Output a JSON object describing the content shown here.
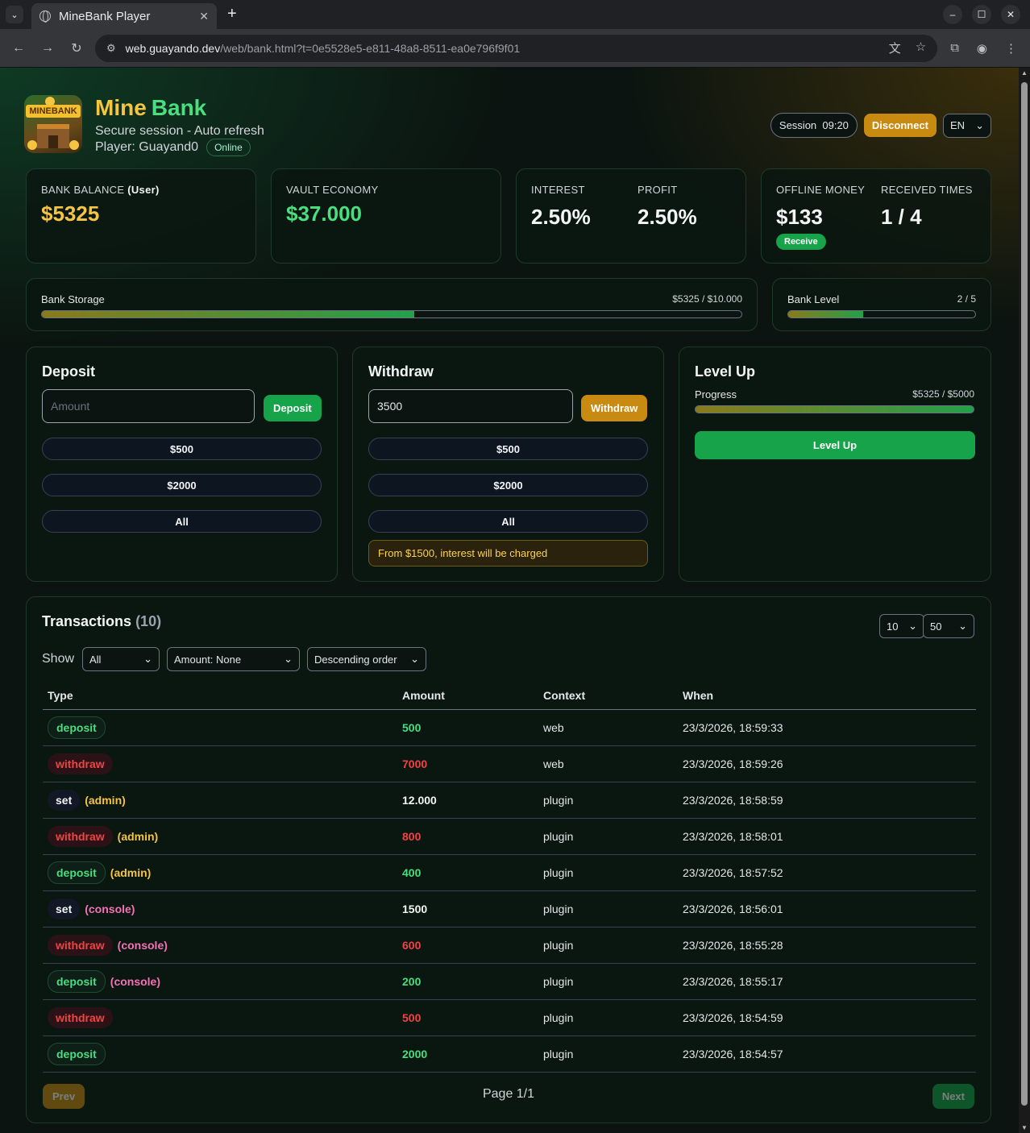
{
  "browser": {
    "tab_title": "MineBank Player",
    "url_host": "web.guayando.dev",
    "url_path": "/web/bank.html?t=0e5528e5-e811-48a8-8511-ea0e796f9f01"
  },
  "header": {
    "brand_1": "Mine",
    "brand_2": "Bank",
    "subtitle": "Secure session - Auto refresh",
    "player_label": "Player: Guayand0",
    "status": "Online",
    "session": "Session  09:20",
    "disconnect": "Disconnect",
    "lang": "EN",
    "logo_text": "MINEBANK"
  },
  "stats": {
    "bank_balance_label": "BANK BALANCE",
    "bank_balance_user": "(User)",
    "bank_balance": "$5325",
    "vault_label": "VAULT ECONOMY",
    "vault": "$37.000",
    "interest_label": "INTEREST",
    "interest": "2.50%",
    "profit_label": "PROFIT",
    "profit": "2.50%",
    "offline_label": "OFFLINE MONEY",
    "offline": "$133",
    "receive": "Receive",
    "received_label": "RECEIVED TIMES",
    "received": "1 / 4"
  },
  "storage": {
    "label": "Bank Storage",
    "value": "$5325 / $10.000",
    "fraction": 0.5325
  },
  "level": {
    "label": "Bank Level",
    "value": "2 / 5",
    "fraction": 0.4
  },
  "deposit": {
    "title": "Deposit",
    "placeholder": "Amount",
    "button": "Deposit",
    "q1": "$500",
    "q2": "$2000",
    "q3": "All"
  },
  "withdraw": {
    "title": "Withdraw",
    "value": "3500",
    "button": "Withdraw",
    "q1": "$500",
    "q2": "$2000",
    "q3": "All",
    "notice": "From $1500, interest will be charged"
  },
  "levelup": {
    "title": "Level Up",
    "progress_label": "Progress",
    "progress_value": "$5325 / $5000",
    "fraction": 1.0,
    "button": "Level Up"
  },
  "transactions": {
    "title": "Transactions",
    "count": "(10)",
    "page_size": "10",
    "limit": "50",
    "show_label": "Show",
    "filter_type": "All",
    "filter_amount": "Amount: None",
    "order": "Descending order",
    "columns": [
      "Type",
      "Amount",
      "Context",
      "When"
    ],
    "rows": [
      {
        "type": "deposit",
        "tag": "",
        "amount": "500",
        "context": "web",
        "when": "23/3/2026, 18:59:33"
      },
      {
        "type": "withdraw",
        "tag": "",
        "amount": "7000",
        "context": "web",
        "when": "23/3/2026, 18:59:26"
      },
      {
        "type": "set",
        "tag": "(admin)",
        "amount": "12.000",
        "context": "plugin",
        "when": "23/3/2026, 18:58:59"
      },
      {
        "type": "withdraw",
        "tag": "(admin)",
        "amount": "800",
        "context": "plugin",
        "when": "23/3/2026, 18:58:01"
      },
      {
        "type": "deposit",
        "tag": "(admin)",
        "amount": "400",
        "context": "plugin",
        "when": "23/3/2026, 18:57:52"
      },
      {
        "type": "set",
        "tag": "(console)",
        "amount": "1500",
        "context": "plugin",
        "when": "23/3/2026, 18:56:01"
      },
      {
        "type": "withdraw",
        "tag": "(console)",
        "amount": "600",
        "context": "plugin",
        "when": "23/3/2026, 18:55:28"
      },
      {
        "type": "deposit",
        "tag": "(console)",
        "amount": "200",
        "context": "plugin",
        "when": "23/3/2026, 18:55:17"
      },
      {
        "type": "withdraw",
        "tag": "",
        "amount": "500",
        "context": "plugin",
        "when": "23/3/2026, 18:54:59"
      },
      {
        "type": "deposit",
        "tag": "",
        "amount": "2000",
        "context": "plugin",
        "when": "23/3/2026, 18:54:57"
      }
    ],
    "prev": "Prev",
    "page": "Page 1/1",
    "next": "Next"
  },
  "colors": {
    "accent_green": "#16a34a",
    "accent_yellow": "#c98a12",
    "deposit": "#4ade80",
    "withdraw": "#ef4444",
    "admin": "#f5c542",
    "console": "#f472b6"
  }
}
